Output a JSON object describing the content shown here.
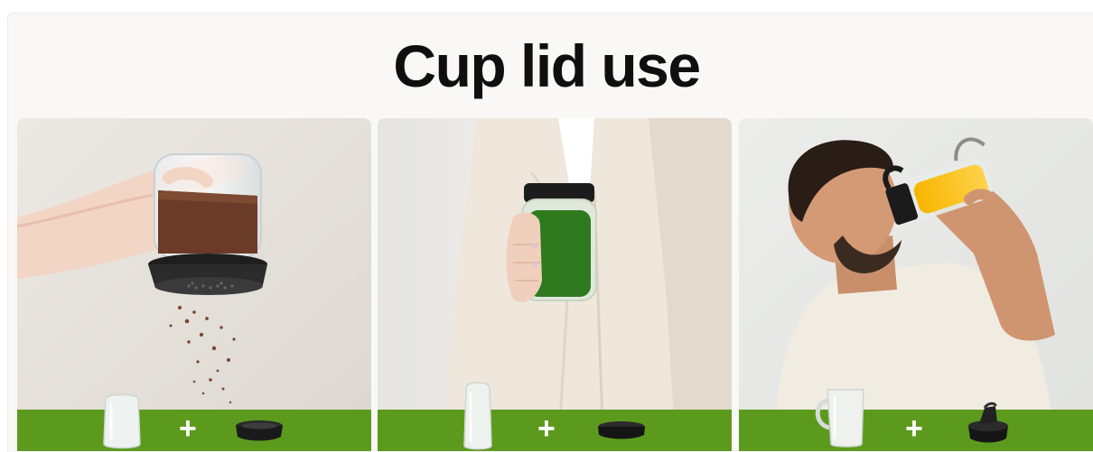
{
  "page": {
    "title": "Cup lid use"
  },
  "cards": [
    {
      "scene": "hand shaking ground coffee through a grated lid",
      "accessory_icons": [
        "short-cup-icon",
        "plus-icon",
        "grated-lid-icon"
      ],
      "plus": "+"
    },
    {
      "scene": "person holding a green smoothie in a sealed cup",
      "accessory_icons": [
        "tall-cup-icon",
        "plus-icon",
        "flat-lid-icon"
      ],
      "plus": "+"
    },
    {
      "scene": "man drinking orange juice from a cup with flip-top lid",
      "accessory_icons": [
        "handled-mug-icon",
        "plus-icon",
        "flip-top-lid-icon"
      ],
      "plus": "+"
    }
  ],
  "colors": {
    "accent_bar": "#5c9a1e",
    "background": "#f9f8f6",
    "title": "#0f0f0f"
  }
}
